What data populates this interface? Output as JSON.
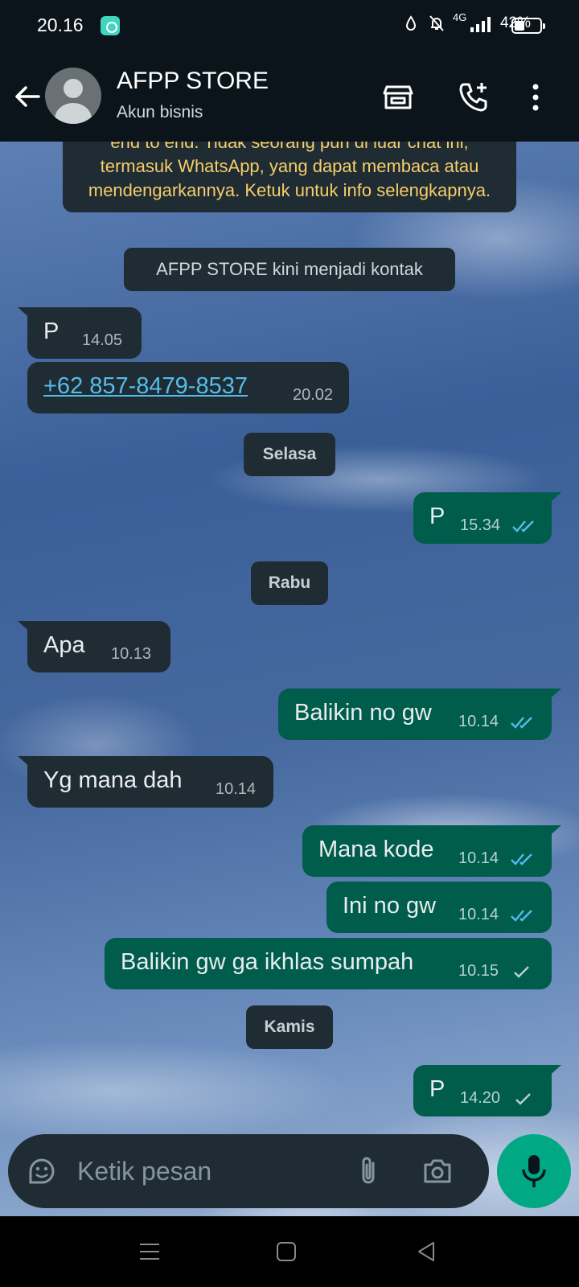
{
  "status_bar": {
    "time": "20.16",
    "network": "4G",
    "battery": "42%"
  },
  "header": {
    "title": "AFPP STORE",
    "subtitle": "Akun bisnis",
    "icons": [
      "back-arrow-icon",
      "store-icon",
      "add-call-icon",
      "more-vert-icon"
    ]
  },
  "chat": {
    "encryption_notice": "end to end. Tidak seorang pun di luar chat ini, termasuk WhatsApp, yang dapat membaca atau mendengarkannya. Ketuk untuk info selengkapnya.",
    "system_notice": "AFPP STORE kini menjadi kontak",
    "days": {
      "tuesday": "Selasa",
      "wednesday": "Rabu",
      "thursday": "Kamis"
    },
    "messages": [
      {
        "dir": "in",
        "text": "P",
        "time": "14.05"
      },
      {
        "dir": "in",
        "text": "+62 857-8479-8537",
        "time": "20.02",
        "link": true
      },
      {
        "dir": "out",
        "text": "P",
        "time": "15.34",
        "status": "read"
      },
      {
        "dir": "in",
        "text": "Apa",
        "time": "10.13"
      },
      {
        "dir": "out",
        "text": "Balikin no gw",
        "time": "10.14",
        "status": "read"
      },
      {
        "dir": "in",
        "text": "Yg mana dah",
        "time": "10.14"
      },
      {
        "dir": "out",
        "text": "Mana kode",
        "time": "10.14",
        "status": "read"
      },
      {
        "dir": "out",
        "text": "Ini no gw",
        "time": "10.14",
        "status": "read"
      },
      {
        "dir": "out",
        "text": "Balikin gw ga ikhlas sumpah",
        "time": "10.15",
        "status": "sent"
      },
      {
        "dir": "out",
        "text": "P",
        "time": "14.20",
        "status": "sent"
      }
    ]
  },
  "input": {
    "placeholder": "Ketik pesan"
  },
  "colors": {
    "header_bg": "#0b141a",
    "incoming_bubble": "#202c33",
    "outgoing_bubble": "#005c4b",
    "read_ticks": "#53bdeb",
    "accent": "#00a884",
    "notice_text": "#f7cd6b"
  }
}
